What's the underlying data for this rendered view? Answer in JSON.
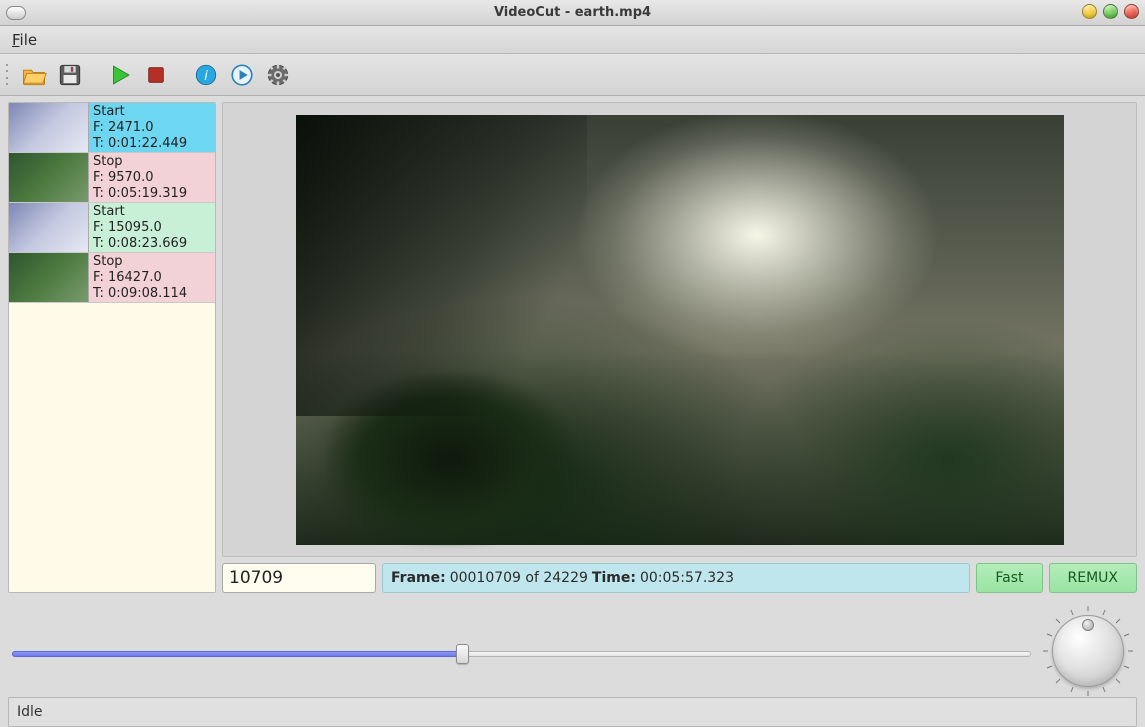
{
  "window": {
    "title": "VideoCut - earth.mp4"
  },
  "menu": {
    "file": "File"
  },
  "toolbar_icons": {
    "open": "open-folder-icon",
    "save": "save-icon",
    "play": "play-icon",
    "stop": "stop-icon",
    "info": "info-icon",
    "playcircle": "play-circle-icon",
    "settings": "gear-icon"
  },
  "cuts": [
    {
      "kind": "Start",
      "frame": "2471.0",
      "time": "0:01:22.449",
      "variant": "start"
    },
    {
      "kind": "Stop",
      "frame": "9570.0",
      "time": "0:05:19.319",
      "variant": "stop"
    },
    {
      "kind": "Start",
      "frame": "15095.0",
      "time": "0:08:23.669",
      "variant": "start alt"
    },
    {
      "kind": "Stop",
      "frame": "16427.0",
      "time": "0:09:08.114",
      "variant": "stop"
    }
  ],
  "frame_spin": "10709",
  "frameinfo": {
    "label_frame": "Frame:",
    "frame_value": "00010709 of 24229",
    "label_time": "Time:",
    "time_value": "00:05:57.323"
  },
  "buttons": {
    "fast": "Fast",
    "remux": "REMUX"
  },
  "slider": {
    "percent": 44.2
  },
  "status": "Idle"
}
